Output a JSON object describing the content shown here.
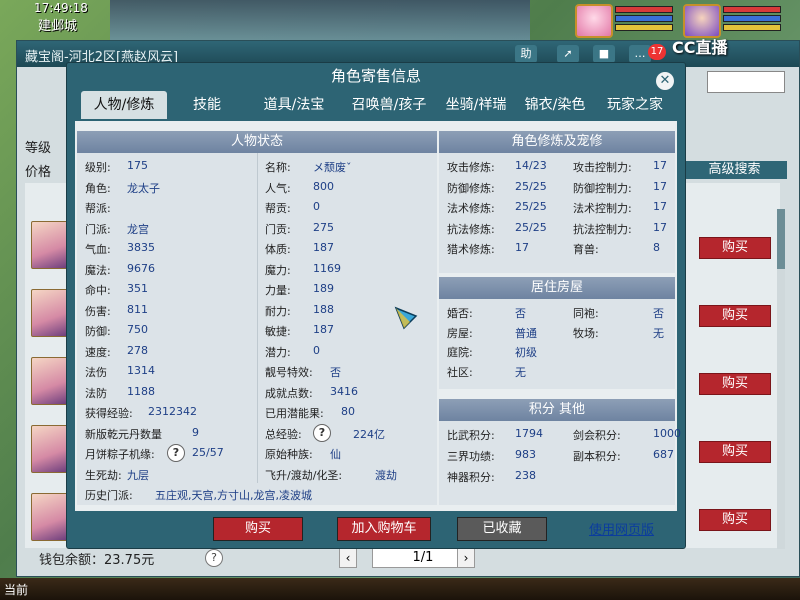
{
  "game": {
    "clock": "17:49:18",
    "city": "建邺城"
  },
  "store": {
    "title": "藏宝阁-河北2区[燕赵风云]",
    "help_btn": "助",
    "labels": {
      "level": "等级",
      "price": "价格"
    },
    "adv_search": "高级搜索",
    "buy_label": "购买",
    "wallet": "钱包余额：23.75元",
    "page": "1/1"
  },
  "overlay": {
    "brand": "CC直播",
    "badge": "17"
  },
  "modal": {
    "title": "角色寄售信息",
    "tabs": [
      "人物/修炼",
      "技能",
      "道具/法宝",
      "召唤兽/孩子",
      "坐骑/祥瑞",
      "锦衣/染色",
      "玩家之家"
    ],
    "status_title": "人物状态",
    "left_col": [
      {
        "k": "级别:",
        "v": "175"
      },
      {
        "k": "角色:",
        "v": "龙太子"
      },
      {
        "k": "帮派:",
        "v": ""
      },
      {
        "k": "门派:",
        "v": "龙宫"
      },
      {
        "k": "气血:",
        "v": "3835"
      },
      {
        "k": "魔法:",
        "v": "9676"
      },
      {
        "k": "命中:",
        "v": "351"
      },
      {
        "k": "伤害:",
        "v": "811"
      },
      {
        "k": "防御:",
        "v": "750"
      },
      {
        "k": "速度:",
        "v": "278"
      },
      {
        "k": "法伤",
        "v": "1314"
      },
      {
        "k": "法防",
        "v": "1188"
      },
      {
        "k": "获得经验:",
        "v": "2312342"
      },
      {
        "k": "新版乾元丹数量",
        "v": "9"
      },
      {
        "k": "月饼粽子机缘:",
        "v": "25/57"
      },
      {
        "k": "生死劫:",
        "v": "九层"
      },
      {
        "k": "历史门派:",
        "v": "五庄观,天宫,方寸山,龙宫,凌波城"
      }
    ],
    "right_col": [
      {
        "k": "名称:",
        "v": "メ颓废ˇ"
      },
      {
        "k": "人气:",
        "v": "800"
      },
      {
        "k": "帮贡:",
        "v": "0"
      },
      {
        "k": "门贡:",
        "v": "275"
      },
      {
        "k": "体质:",
        "v": "187"
      },
      {
        "k": "魔力:",
        "v": "1169"
      },
      {
        "k": "力量:",
        "v": "189"
      },
      {
        "k": "耐力:",
        "v": "188"
      },
      {
        "k": "敏捷:",
        "v": "187"
      },
      {
        "k": "潜力:",
        "v": "0"
      },
      {
        "k": "靓号特效:",
        "v": "否"
      },
      {
        "k": "成就点数:",
        "v": "3416"
      },
      {
        "k": "已用潜能果:",
        "v": "80"
      },
      {
        "k": "总经验:",
        "v": "224亿"
      },
      {
        "k": "原始种族:",
        "v": "仙"
      },
      {
        "k": "飞升/渡劫/化圣:",
        "v": "渡劫"
      }
    ],
    "cultivation_title": "角色修炼及宠修",
    "cultivation": [
      {
        "k": "攻击修炼:",
        "v": "14/23",
        "k2": "攻击控制力:",
        "v2": "17"
      },
      {
        "k": "防御修炼:",
        "v": "25/25",
        "k2": "防御控制力:",
        "v2": "17"
      },
      {
        "k": "法术修炼:",
        "v": "25/25",
        "k2": "法术控制力:",
        "v2": "17"
      },
      {
        "k": "抗法修炼:",
        "v": "25/25",
        "k2": "抗法控制力:",
        "v2": "17"
      },
      {
        "k": "猎术修炼:",
        "v": "17",
        "k2": "育兽:",
        "v2": "8"
      }
    ],
    "house_title": "居住房屋",
    "house": [
      {
        "k": "婚否:",
        "v": "否",
        "k2": "同袍:",
        "v2": "否"
      },
      {
        "k": "房屋:",
        "v": "普通",
        "k2": "牧场:",
        "v2": "无"
      },
      {
        "k": "庭院:",
        "v": "初级",
        "k2": "",
        "v2": ""
      },
      {
        "k": "社区:",
        "v": "无",
        "k2": "",
        "v2": ""
      }
    ],
    "score_title": "积分 其他",
    "score": [
      {
        "k": "比武积分:",
        "v": "1794",
        "k2": "剑会积分:",
        "v2": "1000"
      },
      {
        "k": "三界功绩:",
        "v": "983",
        "k2": "副本积分:",
        "v2": "687"
      },
      {
        "k": "神器积分:",
        "v": "238",
        "k2": "",
        "v2": ""
      }
    ],
    "footer": {
      "buy": "购买",
      "cart": "加入购物车",
      "collected": "已收藏",
      "web": "使用网页版"
    }
  },
  "bottom": {
    "label": "当前"
  },
  "colors": {
    "modal_bg": "#2d6474",
    "panel_head": "#6e83a1",
    "value_text": "#1e3f86",
    "buy_red": "#b5262d",
    "collected_gray": "#5a5a5a"
  }
}
